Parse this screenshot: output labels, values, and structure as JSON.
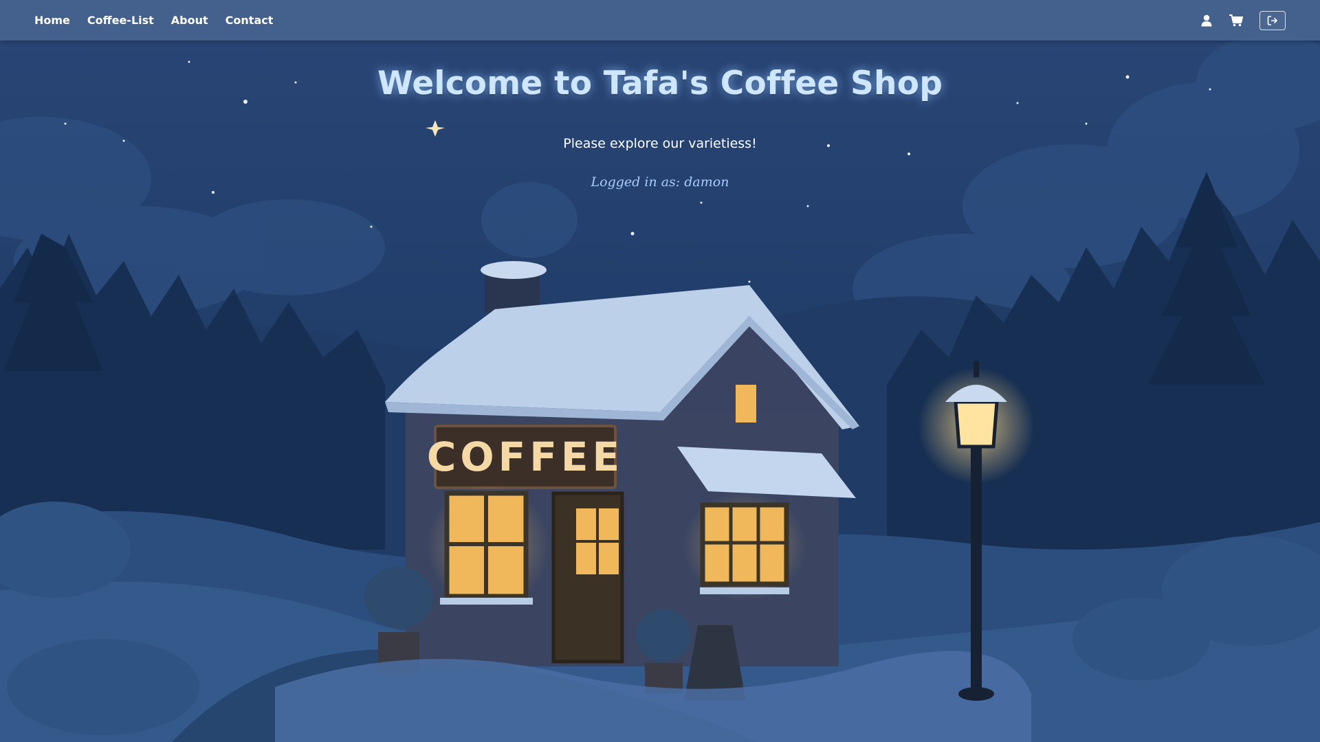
{
  "nav": {
    "links": [
      "Home",
      "Coffee-List",
      "About",
      "Contact"
    ],
    "icons": [
      "user-icon",
      "cart-icon",
      "logout-icon"
    ]
  },
  "hero": {
    "title": "Welcome to Tafa's Coffee Shop",
    "subtitle": "Please explore our varietiess!",
    "logged_in": "Logged in as: damon"
  },
  "scene": {
    "sign_text": "COFFEE",
    "icons": [
      "star-icon",
      "tree-icon",
      "lamp-icon",
      "house-icon"
    ]
  },
  "colors": {
    "nav_bg": "#4a6691",
    "sky_top": "#243e6b",
    "sky_bottom": "#1a3156",
    "title": "#cfe6ff",
    "user_text": "#a9ccff",
    "window_light": "#f0b85a"
  }
}
